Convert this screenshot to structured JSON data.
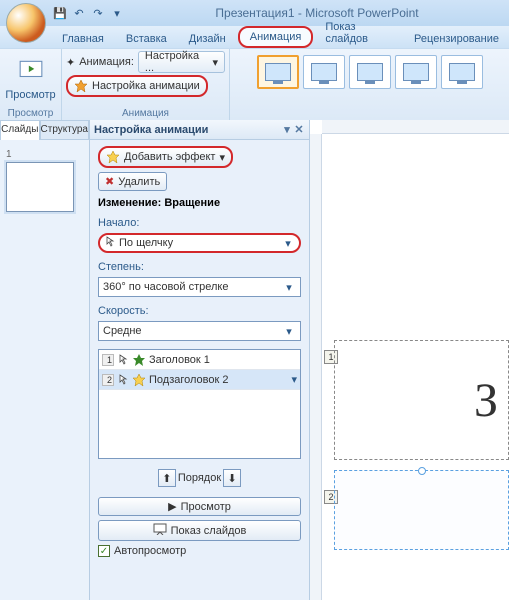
{
  "title": "Презентация1 - Microsoft PowerPoint",
  "menu": {
    "home": "Главная",
    "insert": "Вставка",
    "design": "Дизайн",
    "anim": "Анимация",
    "slideshow": "Показ слайдов",
    "review": "Рецензирование"
  },
  "ribbon": {
    "preview": "Просмотр",
    "preview_group": "Просмотр",
    "anim_label": "Анимация:",
    "anim_value": "Настройка ...",
    "custom_anim": "Настройка анимации",
    "anim_group": "Анимация"
  },
  "left": {
    "slides": "Слайды",
    "structure": "Структура",
    "slide_num": "1"
  },
  "pane": {
    "title": "Настройка анимации",
    "add_effect": "Добавить эффект",
    "delete": "Удалить",
    "change_title": "Изменение: Вращение",
    "start_label": "Начало:",
    "start_value": "По щелчку",
    "degree_label": "Степень:",
    "degree_value": "360° по часовой стрелке",
    "speed_label": "Скорость:",
    "speed_value": "Средне",
    "items": [
      {
        "n": "1",
        "name": "Заголовок 1"
      },
      {
        "n": "2",
        "name": "Подзаголовок 2"
      }
    ],
    "order": "Порядок",
    "preview_btn": "Просмотр",
    "slideshow_btn": "Показ слайдов",
    "autopreview": "Автопросмотр"
  },
  "canvas": {
    "text": "З",
    "tag1": "1",
    "tag2": "2"
  }
}
